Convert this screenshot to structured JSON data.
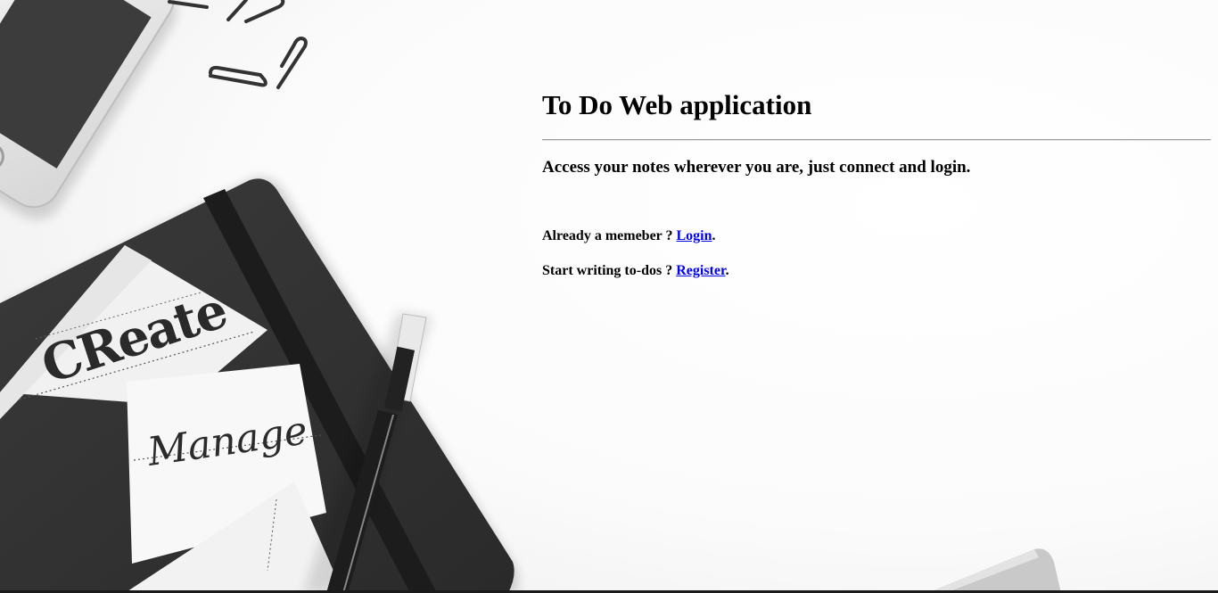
{
  "page": {
    "title": "To Do Web application",
    "tagline": "Access your notes wherever you are, just connect and login."
  },
  "login_line": {
    "prefix": "Already a memeber ? ",
    "link_label": "Login",
    "suffix": "."
  },
  "register_line": {
    "prefix": "Start writing to-dos ? ",
    "link_label": "Register",
    "suffix": "."
  },
  "background": {
    "description_icons": [
      "phone-icon",
      "paperclip-icon",
      "notebook-icon",
      "pen-icon"
    ],
    "handwritten_cards": [
      "Create",
      "Manage"
    ]
  },
  "colors": {
    "link": "#0000ee",
    "text": "#000000",
    "rule": "#9a9a9a",
    "background": "#ffffff"
  }
}
